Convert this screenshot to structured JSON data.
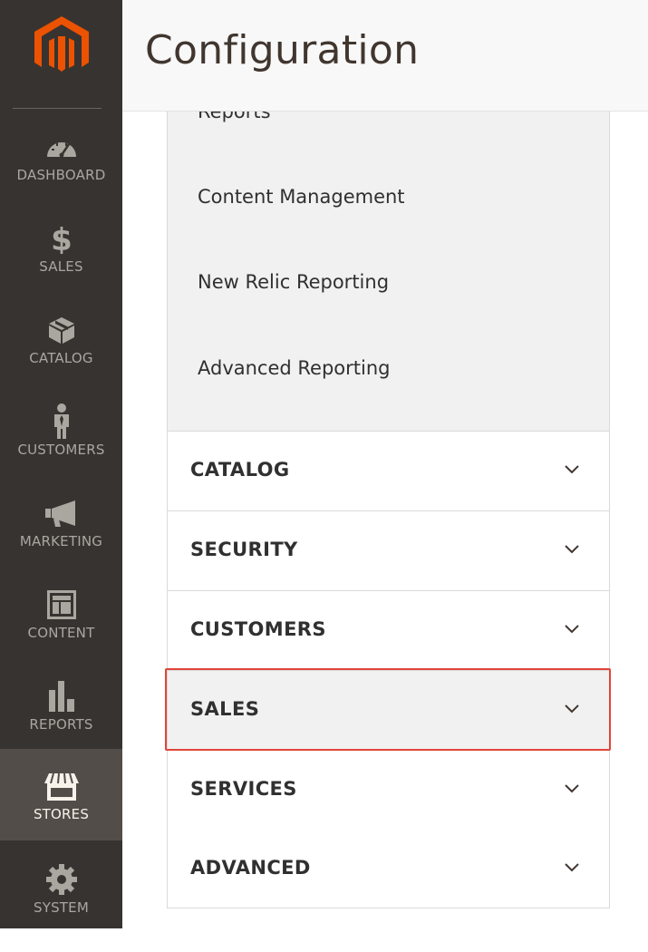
{
  "header": {
    "title": "Configuration"
  },
  "nav": {
    "items": [
      {
        "label": "DASHBOARD",
        "icon": "dashboard-icon"
      },
      {
        "label": "SALES",
        "icon": "dollar-icon"
      },
      {
        "label": "CATALOG",
        "icon": "box-icon"
      },
      {
        "label": "CUSTOMERS",
        "icon": "person-icon"
      },
      {
        "label": "MARKETING",
        "icon": "megaphone-icon"
      },
      {
        "label": "CONTENT",
        "icon": "layout-icon"
      },
      {
        "label": "REPORTS",
        "icon": "bar-chart-icon"
      },
      {
        "label": "STORES",
        "icon": "storefront-icon",
        "active": true
      },
      {
        "label": "SYSTEM",
        "icon": "gear-icon"
      }
    ]
  },
  "config": {
    "subitems": [
      "Reports",
      "Content Management",
      "New Relic Reporting",
      "Advanced Reporting"
    ],
    "sections": [
      {
        "label": "CATALOG"
      },
      {
        "label": "SECURITY"
      },
      {
        "label": "CUSTOMERS"
      },
      {
        "label": "SALES",
        "highlighted": true
      },
      {
        "label": "SERVICES"
      },
      {
        "label": "ADVANCED"
      }
    ]
  },
  "colors": {
    "nav_bg": "#373330",
    "nav_active_bg": "#524d49",
    "logo_orange": "#eb5202",
    "highlight_border": "#e0453a"
  }
}
